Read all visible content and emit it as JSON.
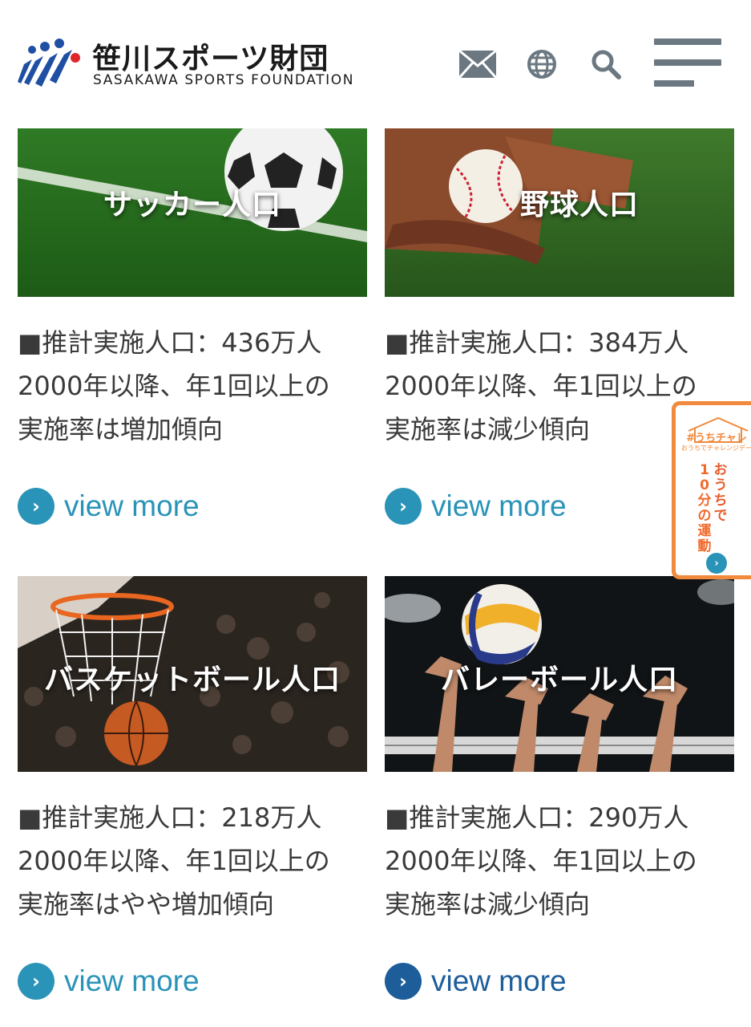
{
  "header": {
    "logo_jp": "笹川スポーツ財団",
    "logo_en": "SASAKAWA SPORTS FOUNDATION",
    "icons": [
      "mail-icon",
      "globe-icon",
      "search-icon",
      "hamburger-menu-icon"
    ]
  },
  "cards": [
    {
      "title": "サッカー人口",
      "line1": "■推計実施人口：436万人",
      "line2": "2000年以降、年1回以上の",
      "line3": "実施率は増加傾向",
      "view_more": "view more"
    },
    {
      "title": "野球人口",
      "line1": "■推計実施人口：384万人",
      "line2": "2000年以降、年1回以上の",
      "line3": "実施率は減少傾向",
      "view_more": "view more"
    },
    {
      "title": "バスケットボール人口",
      "line1": "■推計実施人口：218万人",
      "line2": "2000年以降、年1回以上の",
      "line3": "実施率はやや増加傾向",
      "view_more": "view more"
    },
    {
      "title": "バレーボール人口",
      "line1": "■推計実施人口：290万人",
      "line2": "2000年以降、年1回以上の",
      "line3": "実施率は減少傾向",
      "view_more": "view more"
    }
  ],
  "side_tab": {
    "tag": "#うちチャレ",
    "sub": "おうちでチャレンジデー",
    "text_a": "おうちで",
    "text_b": "10分の運動"
  },
  "colors": {
    "accent": "#2a93b8",
    "accent_dark": "#1c5d9a",
    "side_tab": "#f08a3c",
    "logo_blue": "#1f4fa3",
    "logo_red": "#e0262b"
  }
}
